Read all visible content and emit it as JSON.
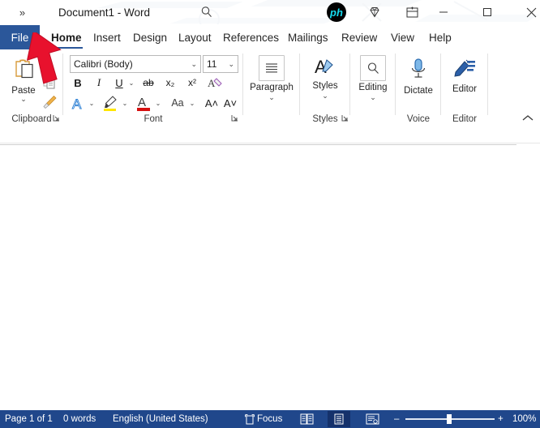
{
  "window": {
    "title": "Document1  -  Word",
    "qat_overflow": "»",
    "search_icon": "search-icon",
    "account_logo_text": "ph",
    "diamond_icon": "diamond-icon",
    "ribbon_display_icon": "ribbon-display-options-icon",
    "minimize_label": "–",
    "maximize_label": "□",
    "close_label": "✕"
  },
  "tabs": {
    "file": "File",
    "items": [
      {
        "label": "Home",
        "active": true
      },
      {
        "label": "Insert",
        "active": false
      },
      {
        "label": "Design",
        "active": false
      },
      {
        "label": "Layout",
        "active": false
      },
      {
        "label": "References",
        "active": false
      },
      {
        "label": "Mailings",
        "active": false
      },
      {
        "label": "Review",
        "active": false
      },
      {
        "label": "View",
        "active": false
      },
      {
        "label": "Help",
        "active": false
      }
    ],
    "comments_label": "comments-icon",
    "comments_chevron": "⌄",
    "share_label": "share-icon"
  },
  "ribbon": {
    "clipboard": {
      "group_label": "Clipboard",
      "paste_label": "Paste",
      "paste_chevron": "⌄",
      "copy_label": "copy-icon",
      "format_painter_label": "format-painter-icon",
      "launcher": "↘"
    },
    "font": {
      "group_label": "Font",
      "font_name": "Calibri (Body)",
      "font_size": "11",
      "bold": "B",
      "italic": "I",
      "underline": "U",
      "underline_chevron": "⌄",
      "strikethrough": "ab",
      "subscript": "x₂",
      "superscript": "x²",
      "clear_formatting": "clear-formatting-icon",
      "text_effects": "A",
      "text_effects_chevron": "⌄",
      "highlight": "highlighter-icon",
      "highlight_chevron": "⌄",
      "font_color": "A",
      "font_color_chevron": "⌄",
      "change_case": "Aa",
      "change_case_chevron": "⌄",
      "grow_font": "A˄",
      "shrink_font": "A˅",
      "launcher": "↘"
    },
    "paragraph": {
      "group_label": "",
      "button_label": "Paragraph",
      "chevron": "⌄"
    },
    "styles": {
      "group_label": "Styles",
      "button_label": "Styles",
      "chevron": "⌄",
      "launcher": "↘"
    },
    "editing": {
      "group_label": "",
      "button_label": "Editing",
      "chevron": "⌄"
    },
    "voice": {
      "group_label": "Voice",
      "button_label": "Dictate"
    },
    "editor": {
      "group_label": "Editor",
      "button_label": "Editor"
    },
    "collapse_chevron": "⌃"
  },
  "status": {
    "page": "Page 1 of 1",
    "words": "0 words",
    "language": "English (United States)",
    "focus_icon": "focus-mode-icon",
    "focus_label": "Focus",
    "view_read": "read-mode-icon",
    "view_print": "print-layout-icon",
    "view_web": "web-layout-icon",
    "zoom_out": "–",
    "zoom_in": "+",
    "zoom_value": "100%"
  },
  "cursor": {
    "name": "red-arrow-pointer"
  },
  "colors": {
    "word_blue": "#2b579a",
    "status_blue": "#20478b",
    "status_selected": "#15316b",
    "accent_logo": "#16dcf0",
    "cursor_red": "#e8112d"
  }
}
